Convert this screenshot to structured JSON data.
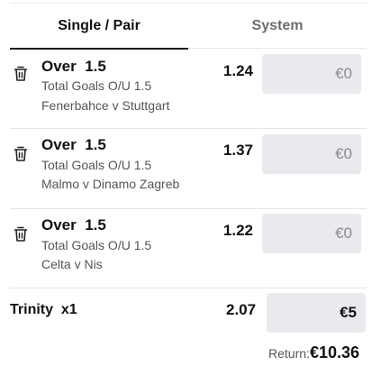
{
  "tabs": {
    "single": "Single / Pair",
    "system": "System"
  },
  "bets": [
    {
      "selection": "Over  1.5",
      "market": "Total Goals O/U 1.5",
      "event": "Fenerbahce v Stuttgart",
      "odds": "1.24",
      "stake": "€0"
    },
    {
      "selection": "Over  1.5",
      "market": "Total Goals O/U 1.5",
      "event": "Malmo v Dinamo Zagreb",
      "odds": "1.37",
      "stake": "€0"
    },
    {
      "selection": "Over  1.5",
      "market": "Total Goals O/U 1.5",
      "event": "Celta v Nis",
      "odds": "1.22",
      "stake": "€0"
    }
  ],
  "trinity": {
    "label": "Trinity  x1",
    "odds": "2.07",
    "stake": "€5"
  },
  "return": {
    "label": "Return:",
    "value": "€10.36"
  },
  "icons": {
    "delete": "trash-icon"
  },
  "colors": {
    "stake_bg": "#e9eaed",
    "tab_active": "#1a1a1a",
    "tab_inactive": "#6e6e6e"
  }
}
